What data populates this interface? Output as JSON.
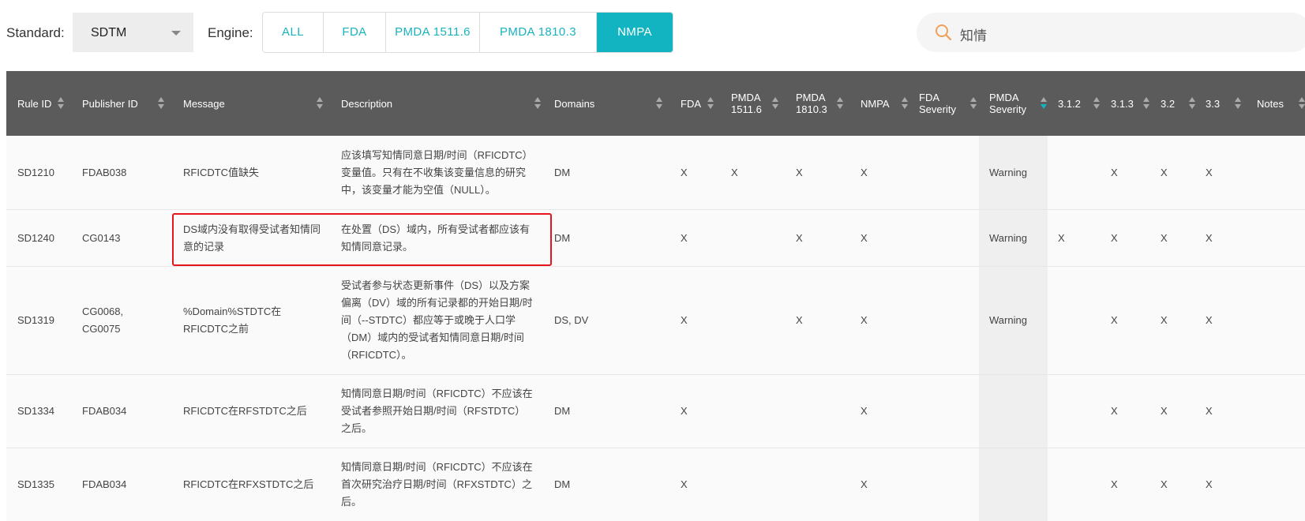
{
  "toolbar": {
    "standard_label": "Standard:",
    "standard_value": "SDTM",
    "engine_label": "Engine:",
    "engines": [
      {
        "label": "ALL",
        "active": false
      },
      {
        "label": "FDA",
        "active": false
      },
      {
        "label": "PMDA 1511.6",
        "active": false
      },
      {
        "label": "PMDA 1810.3",
        "active": false
      },
      {
        "label": "NMPA",
        "active": true
      }
    ],
    "search_value": "知情",
    "accent_color": "#13b4c1"
  },
  "table": {
    "headers": [
      "Rule ID",
      "Publisher ID",
      "Message",
      "Description",
      "Domains",
      "FDA",
      "PMDA\n1511.6",
      "PMDA\n1810.3",
      "NMPA",
      "FDA\nSeverity",
      "PMDA\nSeverity",
      "3.1.2",
      "3.1.3",
      "3.2",
      "3.3",
      "Notes"
    ],
    "sorted_column": "PMDA\nSeverity",
    "rows": [
      {
        "rule_id": "SD1210",
        "publisher_id": "FDAB038",
        "message": "RFICDTC值缺失",
        "description": "应该填写知情同意日期/时间（RFICDTC）变量值。只有在不收集该变量信息的研究中，该变量才能为空值（NULL）。",
        "domains": "DM",
        "fda": "X",
        "pmda15": "X",
        "pmda18": "X",
        "nmpa": "X",
        "fda_sev": "",
        "pmda_sev": "Warning",
        "v312": "",
        "v313": "X",
        "v32": "X",
        "v33": "X",
        "notes": ""
      },
      {
        "rule_id": "SD1240",
        "publisher_id": "CG0143",
        "message": "DS域内没有取得受试者知情同意的记录",
        "description": "在处置（DS）域内，所有受试者都应该有知情同意记录。",
        "domains": "DM",
        "fda": "X",
        "pmda15": "",
        "pmda18": "X",
        "nmpa": "X",
        "fda_sev": "",
        "pmda_sev": "Warning",
        "v312": "X",
        "v313": "X",
        "v32": "X",
        "v33": "X",
        "notes": ""
      },
      {
        "rule_id": "SD1319",
        "publisher_id": "CG0068, CG0075",
        "message": "%Domain%STDTC在RFICDTC之前",
        "description": "受试者参与状态更新事件（DS）以及方案偏离（DV）域的所有记录都的开始日期/时间（--STDTC）都应等于或晚于人口学（DM）域内的受试者知情同意日期/时间（RFICDTC）。",
        "domains": "DS, DV",
        "fda": "X",
        "pmda15": "",
        "pmda18": "X",
        "nmpa": "X",
        "fda_sev": "",
        "pmda_sev": "Warning",
        "v312": "",
        "v313": "X",
        "v32": "X",
        "v33": "X",
        "notes": ""
      },
      {
        "rule_id": "SD1334",
        "publisher_id": "FDAB034",
        "message": "RFICDTC在RFSTDTC之后",
        "description": "知情同意日期/时间（RFICDTC）不应该在受试者参照开始日期/时间（RFSTDTC）之后。",
        "domains": "DM",
        "fda": "X",
        "pmda15": "",
        "pmda18": "",
        "nmpa": "X",
        "fda_sev": "",
        "pmda_sev": "",
        "v312": "",
        "v313": "X",
        "v32": "X",
        "v33": "X",
        "notes": ""
      },
      {
        "rule_id": "SD1335",
        "publisher_id": "FDAB034",
        "message": "RFICDTC在RFXSTDTC之后",
        "description": "知情同意日期/时间（RFICDTC）不应该在首次研究治疗日期/时间（RFXSTDTC）之后。",
        "domains": "DM",
        "fda": "X",
        "pmda15": "",
        "pmda18": "",
        "nmpa": "X",
        "fda_sev": "",
        "pmda_sev": "",
        "v312": "",
        "v313": "X",
        "v32": "X",
        "v33": "X",
        "notes": ""
      }
    ]
  },
  "annotation": {
    "color": "#e8141d"
  }
}
